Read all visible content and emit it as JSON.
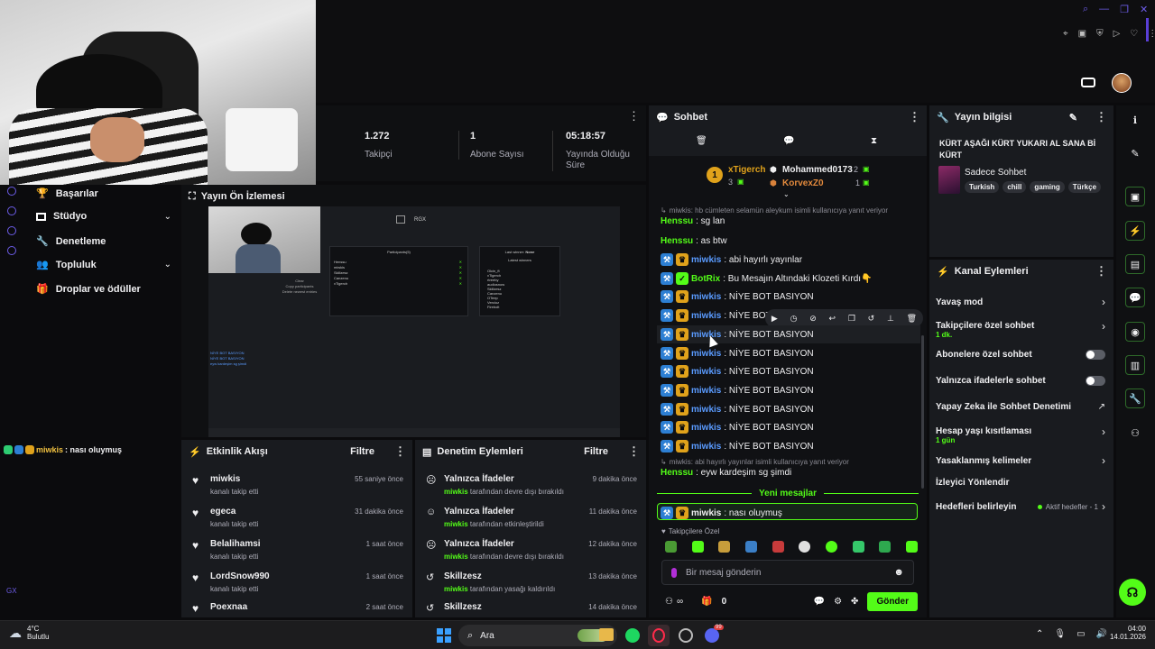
{
  "stats": [
    {
      "value": "1.272",
      "label": "Takipçi"
    },
    {
      "value": "1",
      "label": "Abone Sayısı"
    },
    {
      "value": "05:18:57",
      "label": "Yayında Olduğu Süre"
    }
  ],
  "nav": [
    {
      "label": "Başarılar"
    },
    {
      "label": "Stüdyo"
    },
    {
      "label": "Denetleme"
    },
    {
      "label": "Topluluk"
    },
    {
      "label": "Droplar ve ödüller"
    }
  ],
  "preview": {
    "title": "Yayın Ön İzlemesi",
    "rgx": "RGX",
    "participants_title": "Participants(5)",
    "participants": [
      "Henssu",
      "miwkis",
      "Skillzesz",
      "Canzenu",
      "xTigerch"
    ],
    "clear": "Clear",
    "copy": "Copy participants",
    "delete": "Delete newest entries",
    "last_winner_label": "Last winner:",
    "last_winner": "None",
    "latest_winners": "Latest winners",
    "winners": [
      "Olcin_ft",
      "xTigerch",
      "rtreeby",
      "audiosnow",
      "Skillzesz",
      "Canzenu",
      "OTeep",
      "Vercioz",
      "Firebolt"
    ],
    "chat_line": "NİYE BOT BASIYON",
    "chat_line2": "eyw kardeşim sg şimdi"
  },
  "left_chat_overlay": {
    "user": "miwkis",
    "text": ": nası oluymuş"
  },
  "activity": {
    "title": "Etkinlik Akışı",
    "filter": "Filtre",
    "items": [
      {
        "name": "miwkis",
        "action": "kanalı takip etti",
        "time": "55 saniye önce"
      },
      {
        "name": "egeca",
        "action": "kanalı takip etti",
        "time": "31 dakika önce"
      },
      {
        "name": "Belalihamsi",
        "action": "kanalı takip etti",
        "time": "1 saat önce"
      },
      {
        "name": "LordSnow990",
        "action": "kanalı takip etti",
        "time": "1 saat önce"
      },
      {
        "name": "Poexnaa",
        "action": "",
        "time": "2 saat önce"
      }
    ]
  },
  "moderation": {
    "title": "Denetim Eylemleri",
    "filter": "Filtre",
    "items": [
      {
        "title": "Yalnızca İfadeler",
        "user": "miwkis",
        "desc": "tarafından devre dışı bırakıldı",
        "time": "9 dakika önce"
      },
      {
        "title": "Yalnızca İfadeler",
        "user": "miwkis",
        "desc": "tarafından etkinleştirildi",
        "time": "11 dakika önce"
      },
      {
        "title": "Yalnızca İfadeler",
        "user": "miwkis",
        "desc": "tarafından devre dışı bırakıldı",
        "time": "12 dakika önce"
      },
      {
        "title": "Skillzesz",
        "user": "miwkis",
        "desc": "tarafından yasağı kaldırıldı",
        "time": "13 dakika önce"
      },
      {
        "title": "Skillzesz",
        "user": "",
        "desc": "",
        "time": "14 dakika önce"
      }
    ]
  },
  "chat": {
    "title": "Sohbet",
    "leader1": {
      "rank": "1",
      "name": "xTigerch",
      "count": "3"
    },
    "leader2": {
      "name": "Mohammed0173",
      "count": "2"
    },
    "leader3": {
      "name": "KorvexZ0",
      "count": "1"
    },
    "reply1": "miwkis: hb cümleten selamün aleykum isimli kullanıcıya yanıt veriyor",
    "henssu1_user": "Henssu",
    "henssu1_text": ": sg lan",
    "henssu2_user": "Henssu",
    "henssu2_text": ": as btw",
    "abi_user": "miwkis",
    "abi_text": ": abi hayırlı yayınlar",
    "botrix_user": "BotRix",
    "botrix_text": ": Bu Mesajın Altındaki Klozeti Kırdı👇",
    "repeat_user": "miwkis",
    "repeat_text": ": NİYE BOT BASIYON",
    "repeat_text_short": ": NİYE BOT BA",
    "reply2": "miwkis: abi hayırlı yayınlar isimli kullanıcıya yanıt veriyor",
    "henssu3_user": "Henssu",
    "henssu3_text": ": eyw kardeşim sg şimdi",
    "new_messages": "Yeni mesajlar",
    "last_user": "miwkis",
    "last_text": ": nası oluymuş",
    "followers_only": "Takipçilere Özel",
    "input_placeholder": "Bir mesaj gönderin",
    "points": "0",
    "send": "Gönder"
  },
  "stream_info": {
    "title": "Yayın bilgisi",
    "stream_title": "KÜRT AŞAĞI KÜRT YUKARI AL SANA Bİ KÜRT",
    "category": "Sadece Sohbet",
    "tags": [
      "Turkish",
      "chill",
      "gaming",
      "Türkçe"
    ]
  },
  "channel_actions": {
    "title": "Kanal Eylemleri",
    "slow": "Yavaş mod",
    "followers": "Takipçilere özel sohbet",
    "followers_sub": "1 dk.",
    "subs": "Abonelere özel sohbet",
    "emotes": "Yalnızca ifadelerle sohbet",
    "ai": "Yapay Zeka ile Sohbet Denetimi",
    "age": "Hesap yaşı kısıtlaması",
    "age_sub": "1 gün",
    "banned": "Yasaklanmış kelimeler",
    "viewer": "İzleyici Yönlendir",
    "goals": "Hedefleri belirleyin",
    "goals_sub": "Aktif hedefler - 1"
  },
  "taskbar": {
    "temp": "4°C",
    "weather": "Bulutlu",
    "search": "Ara",
    "time": "04:00",
    "date": "14.01.2026",
    "discord_badge": "99"
  },
  "colors": {
    "accent": "#53fc18",
    "bg": "#0b0b0d",
    "panel": "#191b1f"
  }
}
